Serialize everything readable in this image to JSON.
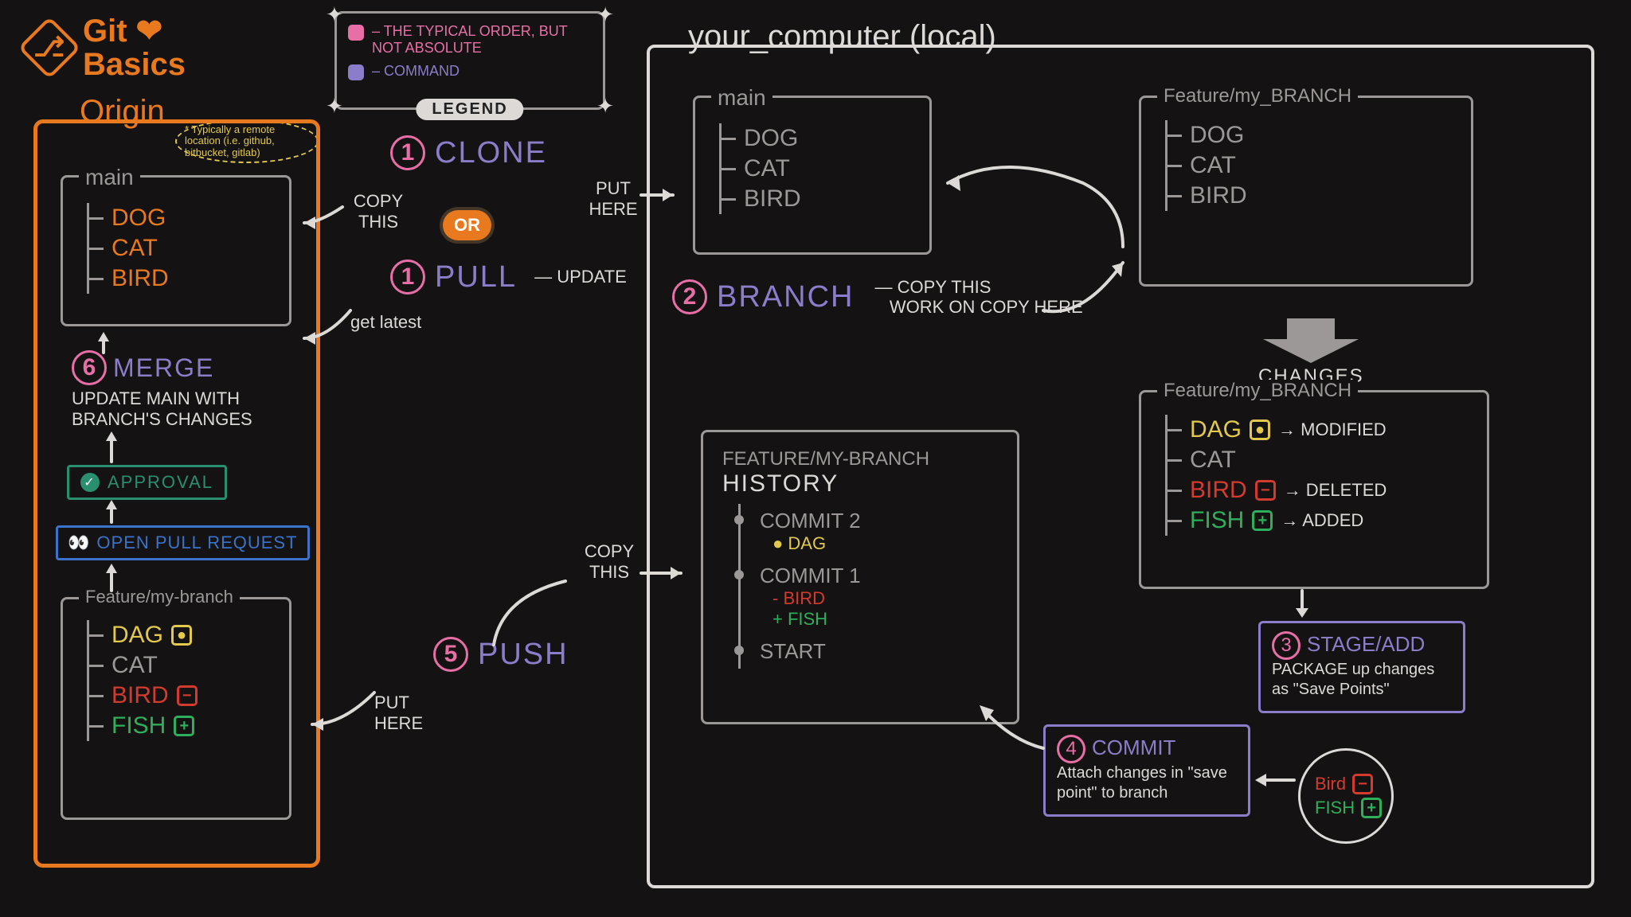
{
  "title": {
    "line1": "Git",
    "line2": "Basics",
    "heart": "❤"
  },
  "legend": {
    "tag": "LEGEND",
    "row1": "– THE TYPICAL ORDER, BUT NOT ABSOLUTE",
    "row2": "– COMMAND"
  },
  "colors": {
    "pink": "#e86fa6",
    "purple": "#8b7dc9"
  },
  "origin": {
    "label": "Origin",
    "note": "* Typically a remote location (i.e. github, bitbucket, gitlab)",
    "main": {
      "title": "main",
      "files": [
        "DOG",
        "CAT",
        "BIRD"
      ]
    },
    "merge": {
      "num": "6",
      "cmd": "MERGE",
      "desc": "UPDATE MAIN WITH BRANCH'S CHANGES"
    },
    "approval": "APPROVAL",
    "pr": "OPEN PULL REQUEST",
    "branch": {
      "title": "Feature/my-branch",
      "files": [
        {
          "name": "DAG",
          "state": "mod"
        },
        {
          "name": "CAT",
          "state": "none"
        },
        {
          "name": "BIRD",
          "state": "del"
        },
        {
          "name": "FISH",
          "state": "add"
        }
      ]
    }
  },
  "local": {
    "label": "your_computer (local)",
    "main": {
      "title": "main",
      "files": [
        "DOG",
        "CAT",
        "BIRD"
      ]
    },
    "feature_clean": {
      "title": "Feature/my_BRANCH",
      "files": [
        "DOG",
        "CAT",
        "BIRD"
      ]
    },
    "changes_label": "CHANGES",
    "feature_changed": {
      "title": "Feature/my_BRANCH",
      "files": [
        {
          "name": "DAG",
          "state": "mod",
          "note": "MODIFIED"
        },
        {
          "name": "CAT",
          "state": "none",
          "note": ""
        },
        {
          "name": "BIRD",
          "state": "del",
          "note": "DELETED"
        },
        {
          "name": "FISH",
          "state": "add",
          "note": "ADDED"
        }
      ]
    },
    "history": {
      "title": "FEATURE/MY-BRANCH",
      "subtitle": "HISTORY",
      "commits": [
        {
          "label": "COMMIT 2",
          "lines": [
            {
              "prefix": "●",
              "text": "DAG",
              "color": "yellow"
            }
          ]
        },
        {
          "label": "COMMIT 1",
          "lines": [
            {
              "prefix": "-",
              "text": "BIRD",
              "color": "red"
            },
            {
              "prefix": "+",
              "text": "FISH",
              "color": "green"
            }
          ]
        },
        {
          "label": "START",
          "lines": []
        }
      ]
    }
  },
  "steps": {
    "clone": {
      "num": "1",
      "cmd": "CLONE",
      "left": "COPY THIS",
      "right": "PUT HERE"
    },
    "or": "OR",
    "pull": {
      "num": "1",
      "cmd": "PULL",
      "right": "UPDATE",
      "left": "get latest"
    },
    "branch": {
      "num": "2",
      "cmd": "BRANCH",
      "line1": "COPY THIS",
      "line2": "WORK ON COPY HERE"
    },
    "stage": {
      "num": "3",
      "cmd": "STAGE/ADD",
      "desc": "PACKAGE up changes as \"Save Points\""
    },
    "commit": {
      "num": "4",
      "cmd": "COMMIT",
      "desc": "Attach changes in \"save point\" to branch"
    },
    "push": {
      "num": "5",
      "cmd": "PUSH",
      "left": "PUT HERE",
      "right": "COPY THIS"
    }
  },
  "savepoint": {
    "items": [
      {
        "name": "Bird",
        "state": "del"
      },
      {
        "name": "FISH",
        "state": "add"
      }
    ]
  }
}
